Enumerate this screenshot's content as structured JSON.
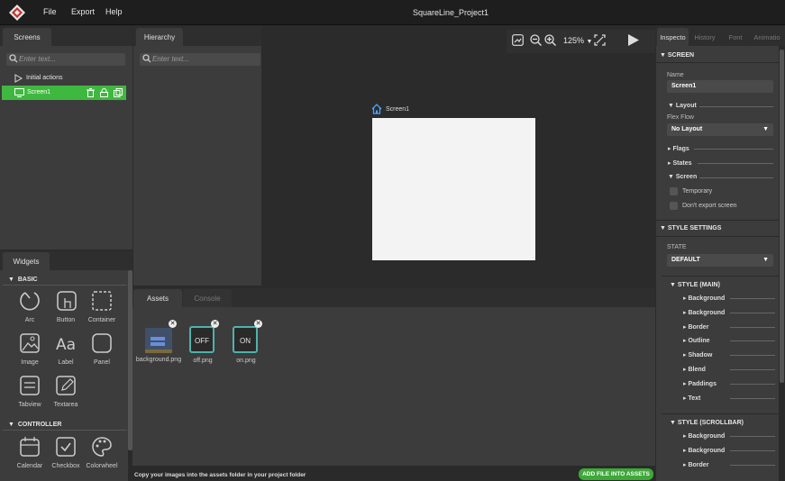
{
  "app": {
    "project_title": "SquareLine_Project1",
    "menu": [
      "File",
      "Export",
      "Help"
    ]
  },
  "screens_panel": {
    "tab": "Screens",
    "search_placeholder": "Enter text...",
    "items": [
      {
        "label": "Initial actions",
        "icon": "play-outline-icon"
      },
      {
        "label": "Screen1",
        "icon": "monitor-icon",
        "selected": true
      }
    ]
  },
  "hierarchy_panel": {
    "tab": "Hierarchy",
    "search_placeholder": "Enter text..."
  },
  "canvas": {
    "zoom": "125%",
    "screen_label": "Screen1",
    "zoom_dropdown_caret": "▼"
  },
  "widgets_panel": {
    "tab": "Widgets",
    "sections": [
      {
        "title": "BASIC",
        "items": [
          "Arc",
          "Button",
          "Container",
          "Image",
          "Label",
          "Panel",
          "Tabview",
          "Textarea"
        ]
      },
      {
        "title": "CONTROLLER",
        "items": [
          "Calendar",
          "Checkbox",
          "Colorwheel"
        ]
      }
    ]
  },
  "assets_panel": {
    "tabs": [
      "Assets",
      "Console"
    ],
    "assets": [
      {
        "label": "background.png",
        "thumb_text": ""
      },
      {
        "label": "off.png",
        "thumb_text": "OFF"
      },
      {
        "label": "on.png",
        "thumb_text": "ON"
      }
    ],
    "footer_hint": "Copy your images into the assets folder in your project folder",
    "add_button": "ADD FILE INTO ASSETS",
    "remove_glyph": "✕"
  },
  "inspector": {
    "tabs": [
      "Inspecto",
      "History",
      "Font",
      "Animatio"
    ],
    "screen_section": "SCREEN",
    "name_label": "Name",
    "name_value": "Screen1",
    "layout_label": "Layout",
    "flex_flow_label": "Flex Flow",
    "flex_flow_value": "No Layout",
    "flags_label": "Flags",
    "states_label": "States",
    "screen_label": "Screen",
    "temporary_label": "Temporary",
    "dont_export_label": "Don't export screen",
    "style_settings": "STYLE SETTINGS",
    "state_label": "STATE",
    "state_value": "DEFAULT",
    "style_main": "STYLE (MAIN)",
    "style_main_items": [
      "Background",
      "Background",
      "Border",
      "Outline",
      "Shadow",
      "Blend",
      "Paddings",
      "Text"
    ],
    "style_scrollbar": "STYLE (SCROLLBAR)",
    "style_scrollbar_items": [
      "Background",
      "Background",
      "Border"
    ]
  },
  "colors": {
    "selected_green": "#3fb83f",
    "accent_teal": "#4fb3a9",
    "add_button_green": "#3ea838",
    "screen_icon_blue": "#4da3ff"
  }
}
